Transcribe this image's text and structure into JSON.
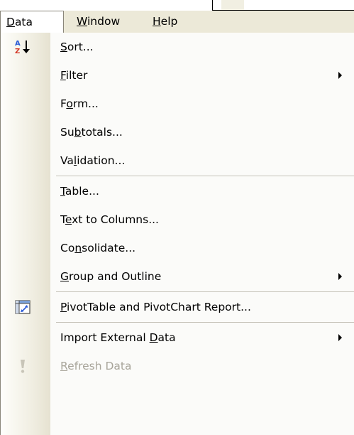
{
  "menubar": {
    "items": [
      {
        "label": "Data",
        "open": true
      },
      {
        "label": "Window"
      },
      {
        "label": "Help"
      }
    ]
  },
  "menu": {
    "items": [
      {
        "label": "Sort...",
        "icon": "sort-ascending-icon"
      },
      {
        "label": "Filter",
        "submenu": true
      },
      {
        "label": "Form..."
      },
      {
        "label": "Subtotals..."
      },
      {
        "label": "Validation..."
      },
      {
        "label": "Table..."
      },
      {
        "label": "Text to Columns..."
      },
      {
        "label": "Consolidate..."
      },
      {
        "label": "Group and Outline",
        "submenu": true
      },
      {
        "label": "PivotTable and PivotChart Report...",
        "icon": "pivot-table-icon"
      },
      {
        "label": "Import External Data",
        "submenu": true
      },
      {
        "label": "Refresh Data",
        "icon": "refresh-exclamation-icon",
        "disabled": true
      }
    ]
  },
  "colors": {
    "menubar_bg": "#ece9d8",
    "menu_bg": "#fbfbf9",
    "disabled_text": "#a8a59a",
    "separator": "#c5c2b8"
  }
}
